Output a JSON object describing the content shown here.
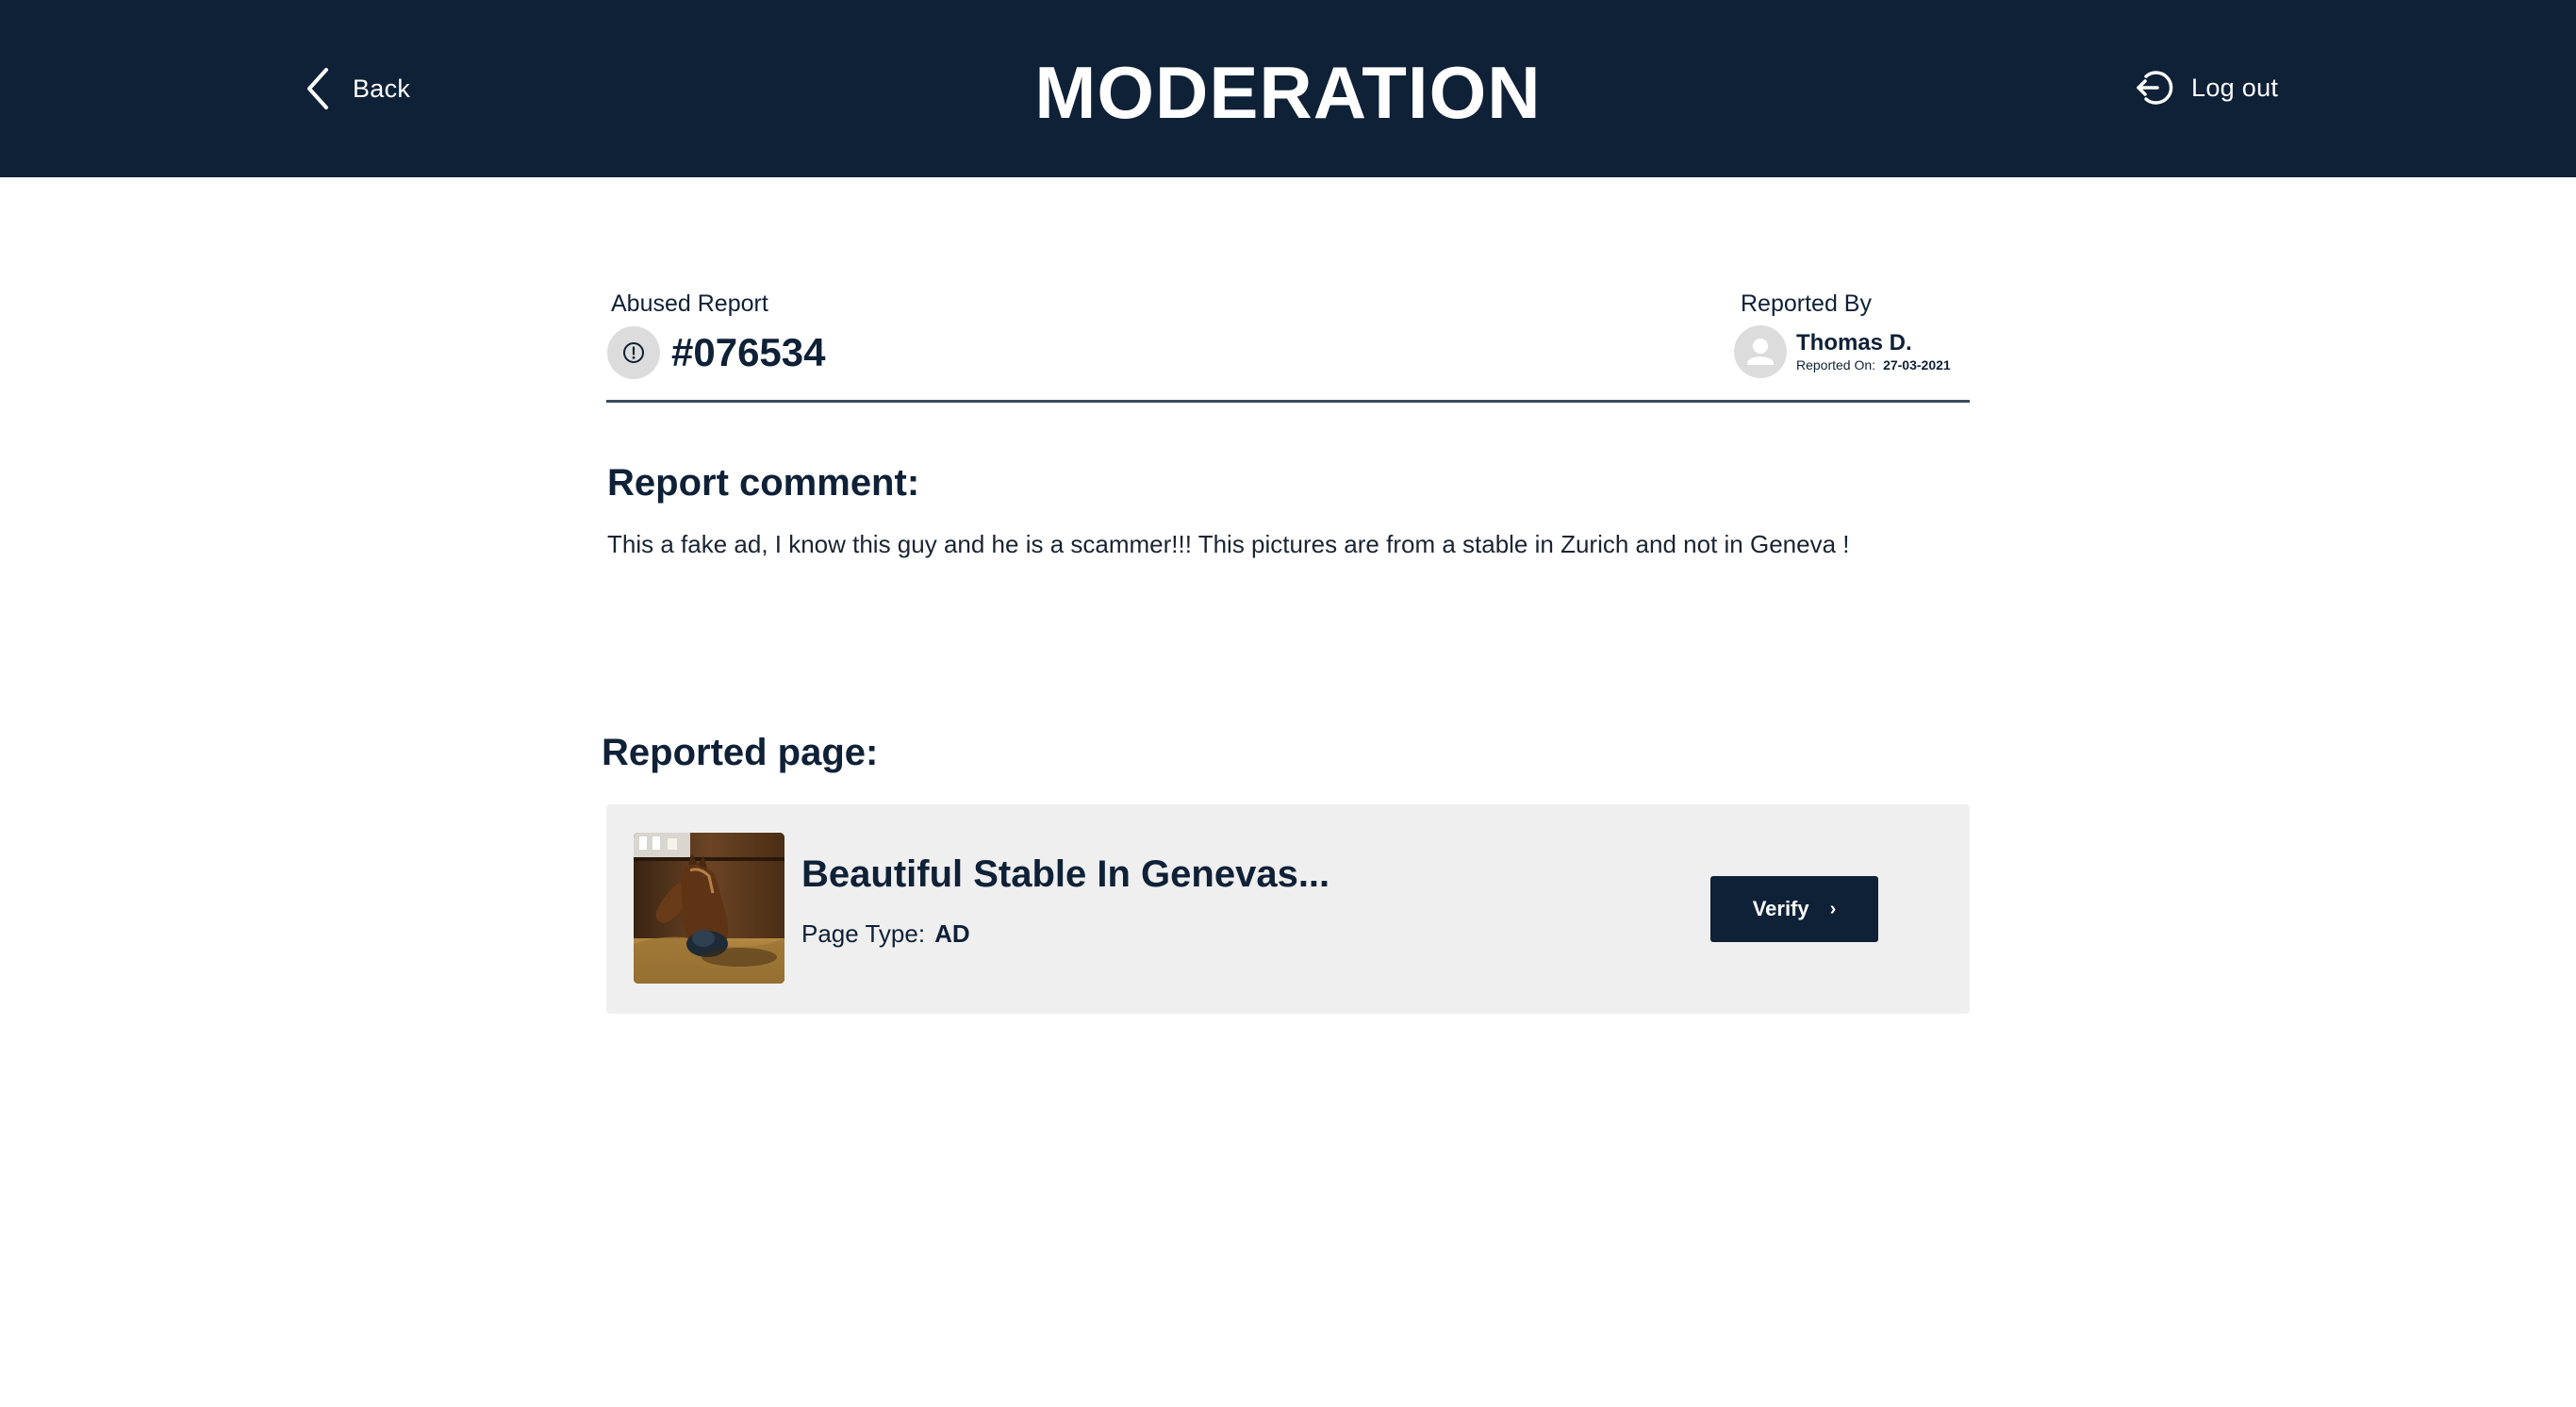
{
  "header": {
    "back_label": "Back",
    "title": "MODERATION",
    "logout_label": "Log out",
    "background_color": "#0f2137"
  },
  "report": {
    "abused_label": "Abused Report",
    "id": "#076534",
    "icon": "alert-circle-icon",
    "reported_by_label": "Reported By",
    "reporter_name": "Thomas D.",
    "reported_on_label": "Reported On:",
    "reported_on_date": "27-03-2021",
    "reporter_icon": "user-avatar-icon"
  },
  "comment": {
    "title": "Report comment:",
    "text": "This a fake ad, I know this guy and he is a scammer!!! This pictures are from a stable in Zurich and not in Geneva !"
  },
  "reported_page": {
    "section_title": "Reported page:",
    "card": {
      "title": "Beautiful Stable In Genevas...",
      "page_type_label": "Page Type:",
      "page_type_value": "AD",
      "verify_label": "Verify",
      "verify_icon": "chevron-right-icon",
      "thumbnail": "horse-in-stable-photo"
    }
  }
}
